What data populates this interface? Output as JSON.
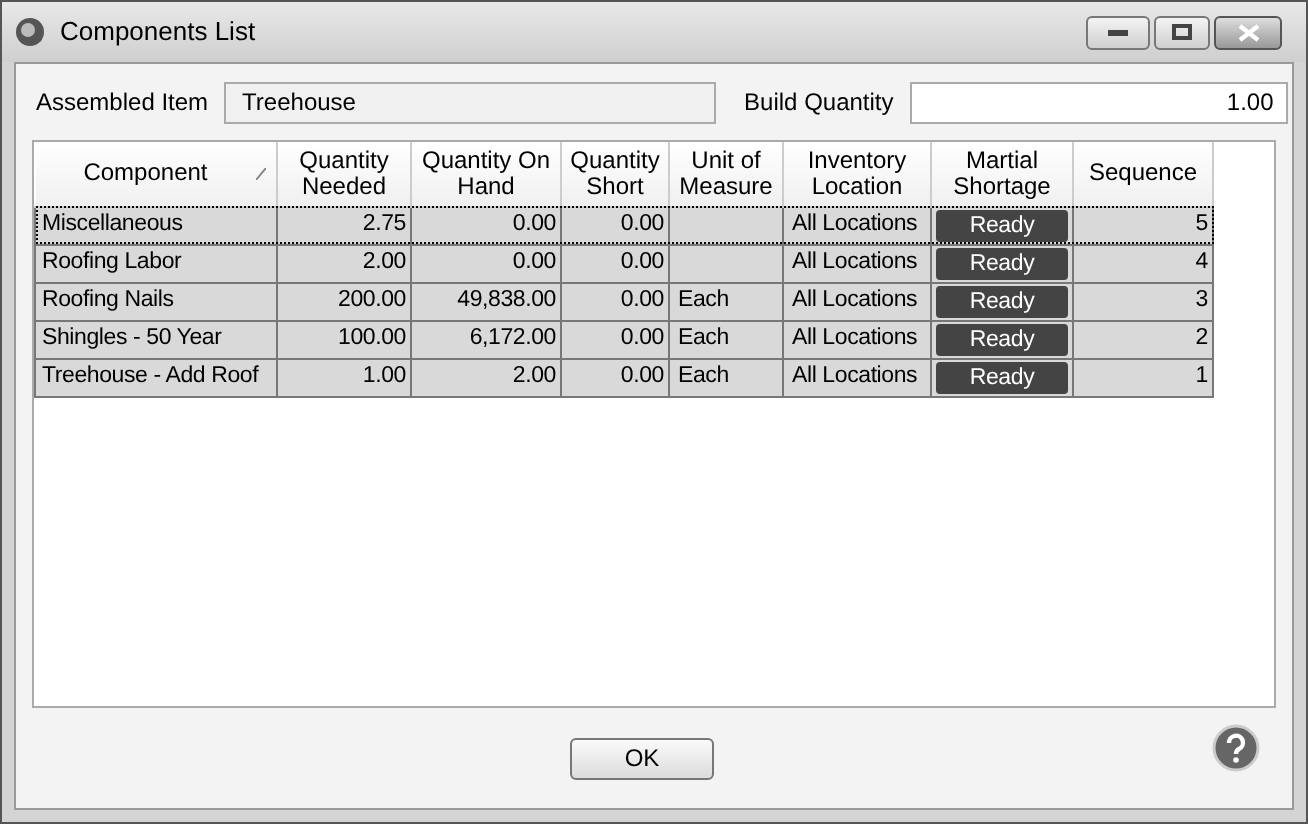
{
  "window": {
    "title": "Components List"
  },
  "assembled_item": {
    "label": "Assembled Item",
    "value": "Treehouse"
  },
  "build_quantity": {
    "label": "Build Quantity",
    "value": "1.00"
  },
  "table": {
    "columns": [
      {
        "label": "Component",
        "sorted": true
      },
      {
        "label": "Quantity Needed",
        "sorted": false
      },
      {
        "label": "Quantity On Hand",
        "sorted": false
      },
      {
        "label": "Quantity Short",
        "sorted": false
      },
      {
        "label": "Unit of Measure",
        "sorted": false
      },
      {
        "label": "Inventory Location",
        "sorted": false
      },
      {
        "label": "Martial Shortage",
        "sorted": false
      },
      {
        "label": "Sequence",
        "sorted": false
      }
    ],
    "rows": [
      {
        "selected": true,
        "cells": [
          "Miscellaneous",
          "2.75",
          "0.00",
          "0.00",
          "",
          "All Locations",
          "Ready",
          "5"
        ]
      },
      {
        "selected": false,
        "cells": [
          "Roofing Labor",
          "2.00",
          "0.00",
          "0.00",
          "",
          "All Locations",
          "Ready",
          "4"
        ]
      },
      {
        "selected": false,
        "cells": [
          "Roofing Nails",
          "200.00",
          "49,838.00",
          "0.00",
          "Each",
          "All Locations",
          "Ready",
          "3"
        ]
      },
      {
        "selected": false,
        "cells": [
          "Shingles - 50 Year",
          "100.00",
          "6,172.00",
          "0.00",
          "Each",
          "All Locations",
          "Ready",
          "2"
        ]
      },
      {
        "selected": false,
        "cells": [
          "Treehouse - Add Roof",
          "1.00",
          "2.00",
          "0.00",
          "Each",
          "All Locations",
          "Ready",
          "1"
        ]
      }
    ]
  },
  "buttons": [
    {
      "label": "OK"
    }
  ]
}
